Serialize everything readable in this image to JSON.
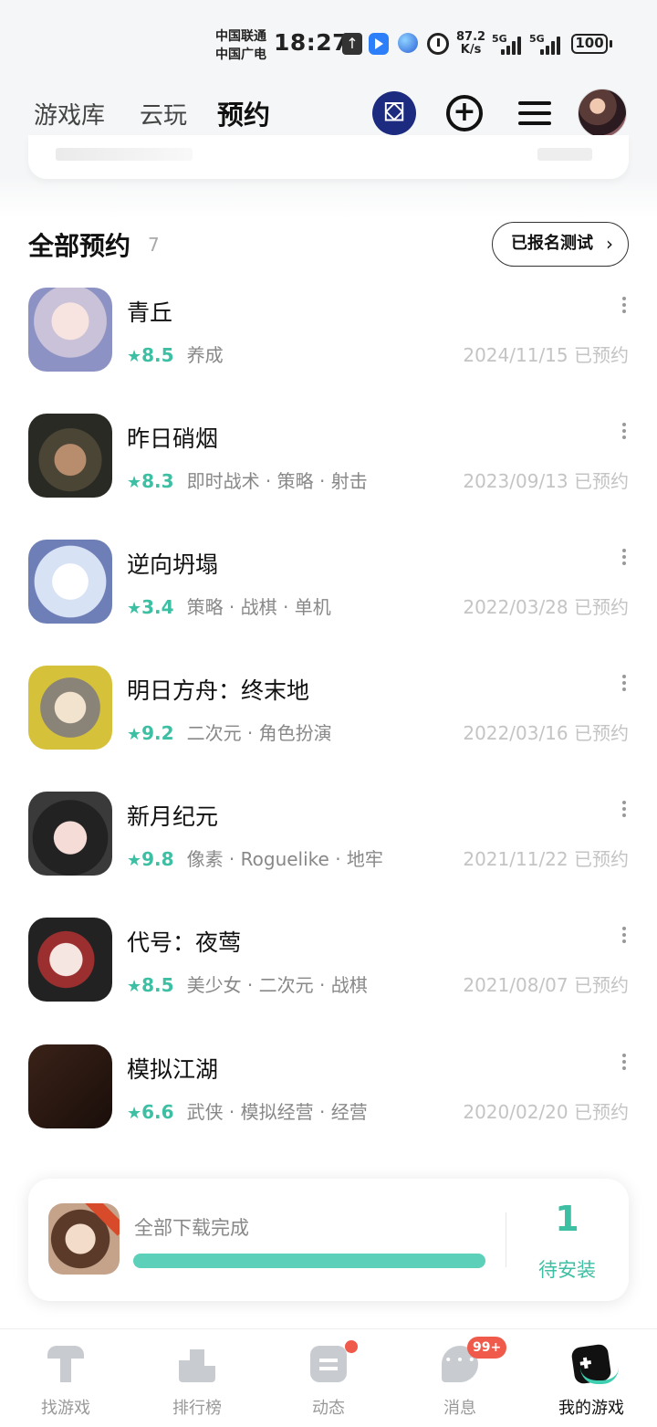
{
  "status_bar": {
    "carrier1": "中国联通",
    "carrier2": "中国广电",
    "time": "18:27",
    "speed_value": "87.2",
    "speed_unit": "K/s",
    "sig1": "5G",
    "sig2": "5G",
    "battery": "100"
  },
  "header": {
    "tabs": [
      {
        "label": "游戏库"
      },
      {
        "label": "云玩"
      },
      {
        "label": "预约"
      }
    ],
    "gift_icon": "gift-icon",
    "add_icon": "plus-circle-icon",
    "menu_icon": "menu-icon"
  },
  "section": {
    "title": "全部预约",
    "count": "7",
    "beta_button": "已报名测试",
    "beta_chevron": "›"
  },
  "games": [
    {
      "name": "青丘",
      "score": "8.5",
      "tags": "养成",
      "date": "2024/11/15 已预约"
    },
    {
      "name": "昨日硝烟",
      "score": "8.3",
      "tags": "即时战术 · 策略 · 射击",
      "date": "2023/09/13 已预约"
    },
    {
      "name": "逆向坍塌",
      "score": "3.4",
      "tags": "策略 · 战棋 · 单机",
      "date": "2022/03/28 已预约"
    },
    {
      "name": "明日方舟：终末地",
      "score": "9.2",
      "tags": "二次元 · 角色扮演",
      "date": "2022/03/16 已预约"
    },
    {
      "name": "新月纪元",
      "score": "9.8",
      "tags": "像素 · Roguelike · 地牢",
      "date": "2021/11/22 已预约"
    },
    {
      "name": "代号：夜莺",
      "score": "8.5",
      "tags": "美少女 · 二次元 · 战棋",
      "date": "2021/08/07 已预约"
    },
    {
      "name": "模拟江湖",
      "score": "6.6",
      "tags": "武侠 · 模拟经营 · 经营",
      "date": "2020/02/20 已预约"
    }
  ],
  "download": {
    "label": "全部下载完成",
    "progress": 1.0,
    "count": "1",
    "pending_label": "待安装"
  },
  "bottom_nav": {
    "items": [
      {
        "label": "找游戏"
      },
      {
        "label": "排行榜"
      },
      {
        "label": "动态"
      },
      {
        "label": "消息",
        "badge": "99+"
      },
      {
        "label": "我的游戏"
      }
    ]
  },
  "colors": {
    "accent": "#3dbfa3",
    "tab_highlight": "#3dcfb0",
    "badge": "#f05a4a"
  }
}
